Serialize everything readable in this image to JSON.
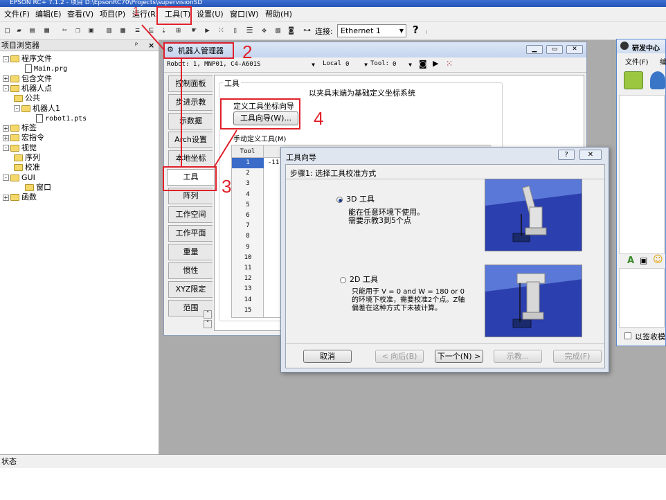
{
  "app": {
    "title": "EPSON RC+ 7.1.2 - 项目 D:\\EpsonRC70\\Projects\\supervisionSD"
  },
  "menubar": {
    "items": [
      "文件(F)",
      "编辑(E)",
      "查看(V)",
      "项目(P)",
      "运行(R)",
      "工具(T)",
      "设置(U)",
      "窗口(W)",
      "帮助(H)"
    ]
  },
  "toolbar": {
    "connect_label": "连接:",
    "connection_value": "Ethernet 1",
    "help_glyph": "?"
  },
  "project_browser": {
    "title": "项目浏览器",
    "pin": "ᵖ",
    "close": "×",
    "tree": [
      {
        "label": "程序文件",
        "indent": 0,
        "pm": "-",
        "kind": "folder"
      },
      {
        "label": "Main.prg",
        "indent": 2,
        "pm": "",
        "kind": "file"
      },
      {
        "label": "包含文件",
        "indent": 0,
        "pm": "+",
        "kind": "folder"
      },
      {
        "label": "机器人点",
        "indent": 0,
        "pm": "-",
        "kind": "folder"
      },
      {
        "label": "公共",
        "indent": 1,
        "pm": "",
        "kind": "folder"
      },
      {
        "label": "机器人1",
        "indent": 1,
        "pm": "-",
        "kind": "folder"
      },
      {
        "label": "robot1.pts",
        "indent": 3,
        "pm": "",
        "kind": "file"
      },
      {
        "label": "标签",
        "indent": 0,
        "pm": "+",
        "kind": "folder"
      },
      {
        "label": "宏指令",
        "indent": 0,
        "pm": "+",
        "kind": "folder"
      },
      {
        "label": "视觉",
        "indent": 0,
        "pm": "-",
        "kind": "folder"
      },
      {
        "label": "序列",
        "indent": 1,
        "pm": "",
        "kind": "folder"
      },
      {
        "label": "校准",
        "indent": 1,
        "pm": "",
        "kind": "folder"
      },
      {
        "label": "GUI",
        "indent": 0,
        "pm": "-",
        "kind": "folder"
      },
      {
        "label": "窗口",
        "indent": 2,
        "pm": "",
        "kind": "folder"
      },
      {
        "label": "函数",
        "indent": 0,
        "pm": "+",
        "kind": "folder"
      }
    ]
  },
  "robot_manager": {
    "title": "机器人管理器",
    "robot_select": "Robot: 1, MNP01, C4-A601S",
    "local_label": "Local",
    "local_value": "0",
    "tool_label": "Tool:",
    "tool_value": "0",
    "tabs": [
      "控制面板",
      "步进示教",
      "示数据",
      "Arch设置",
      "本地坐标",
      "工具",
      "阵列",
      "工作空间",
      "工作平面",
      "重量",
      "惯性",
      "XYZ限定",
      "范围"
    ],
    "active_tab": "工具",
    "page": {
      "group_title": "工具",
      "description": "以夹具末端为基础定义坐标系统",
      "define_wizard_label": "定义工具坐标向导",
      "wizard_button": "工具向导(W)...",
      "manual_label": "手动定义工具(M)",
      "grid_header": "Tool",
      "grid_rows": [
        "1",
        "2",
        "3",
        "4",
        "5",
        "6",
        "7",
        "8",
        "9",
        "10",
        "11",
        "12",
        "13",
        "14",
        "15"
      ],
      "partial_value": "-11"
    }
  },
  "wizard": {
    "title": "工具向导",
    "help_button": "?",
    "close_button": "✕",
    "step_label": "步骤1: 选择工具校准方式",
    "option_3d": {
      "label": "3D 工具",
      "selected": true,
      "desc_lines": [
        "能在任意环境下使用。",
        "需要示教3到5个点"
      ]
    },
    "option_2d": {
      "label": "2D 工具",
      "selected": false,
      "desc_lines": [
        "只能用于 V = 0 and W = 180 or 0",
        "的环境下校准，需要校准2个点。Z轴",
        "偏差在这种方式下未被计算。"
      ]
    },
    "buttons": {
      "cancel": "取消",
      "back": "< 向后(B)",
      "next": "下一个(N) >",
      "teach": "示教...",
      "finish": "完成(F)"
    }
  },
  "message_center": {
    "title": "研发中心",
    "menu_file": "文件(F)",
    "menu_more": "编",
    "checkbox_label": "以签收模"
  },
  "statusbar": {
    "text": "状态"
  },
  "annotations": {
    "n1": "1",
    "n2": "2",
    "n3": "3",
    "n4": "4",
    "color": "#e0202a"
  }
}
